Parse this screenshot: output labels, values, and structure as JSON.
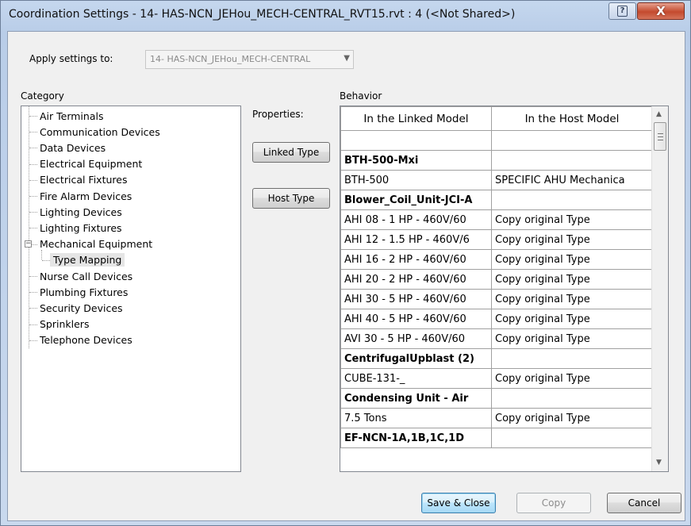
{
  "window": {
    "title": "Coordination Settings - 14- HAS-NCN_JEHou_MECH-CENTRAL_RVT15.rvt : 4 (<Not Shared>)",
    "help_glyph": "?",
    "close_glyph": "X"
  },
  "apply": {
    "label": "Apply settings to:",
    "value": "14- HAS-NCN_JEHou_MECH-CENTRAL"
  },
  "category": {
    "label": "Category",
    "items": [
      "Air Terminals",
      "Communication Devices",
      "Data Devices",
      "Electrical Equipment",
      "Electrical Fixtures",
      "Fire Alarm Devices",
      "Lighting Devices",
      "Lighting Fixtures",
      "Mechanical Equipment",
      "Type Mapping",
      "Nurse Call Devices",
      "Plumbing Fixtures",
      "Security Devices",
      "Sprinklers",
      "Telephone Devices"
    ],
    "expander": "−"
  },
  "properties": {
    "label": "Properties:",
    "linked_type": "Linked Type",
    "host_type": "Host Type"
  },
  "behavior": {
    "label": "Behavior",
    "headers": [
      "In the Linked Model",
      "In the Host Model"
    ],
    "rows": [
      {
        "linked": "",
        "host": "",
        "group": false
      },
      {
        "linked": "BTH-500-Mxi",
        "host": "",
        "group": true
      },
      {
        "linked": "BTH-500",
        "host": "SPECIFIC AHU Mechanica",
        "group": false
      },
      {
        "linked": "Blower_Coil_Unit-JCI-A",
        "host": "",
        "group": true
      },
      {
        "linked": "AHI 08 - 1 HP - 460V/60",
        "host": "Copy original Type",
        "group": false
      },
      {
        "linked": "AHI 12 - 1.5 HP - 460V/6",
        "host": "Copy original Type",
        "group": false
      },
      {
        "linked": "AHI 16 - 2 HP - 460V/60",
        "host": "Copy original Type",
        "group": false
      },
      {
        "linked": "AHI 20 - 2 HP - 460V/60",
        "host": "Copy original Type",
        "group": false
      },
      {
        "linked": "AHI 30 - 5 HP - 460V/60",
        "host": "Copy original Type",
        "group": false
      },
      {
        "linked": "AHI 40 - 5 HP - 460V/60",
        "host": "Copy original Type",
        "group": false
      },
      {
        "linked": "AVI 30 - 5 HP - 460V/60",
        "host": "Copy original Type",
        "group": false
      },
      {
        "linked": "CentrifugalUpblast (2)",
        "host": "",
        "group": true
      },
      {
        "linked": "CUBE-131-_",
        "host": "Copy original Type",
        "group": false
      },
      {
        "linked": "Condensing Unit - Air",
        "host": "",
        "group": true
      },
      {
        "linked": "7.5 Tons",
        "host": "Copy original Type",
        "group": false
      },
      {
        "linked": "EF-NCN-1A,1B,1C,1D",
        "host": "",
        "group": true
      }
    ]
  },
  "footer": {
    "save_close": "Save & Close",
    "copy": "Copy",
    "cancel": "Cancel"
  }
}
